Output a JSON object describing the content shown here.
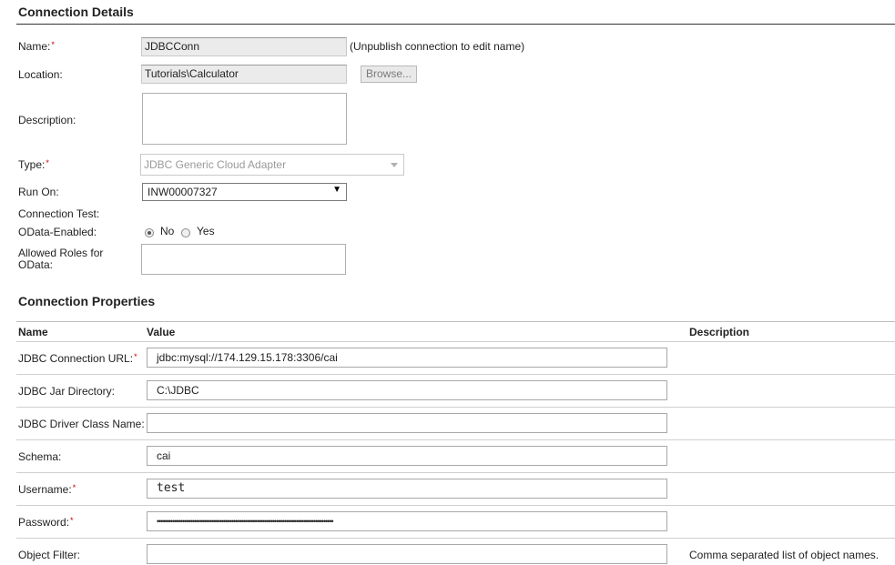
{
  "connection_details": {
    "title": "Connection Details",
    "name": {
      "label": "Name:",
      "required_marker": "*",
      "value": "JDBCConn",
      "note": "(Unpublish connection to edit name)"
    },
    "location": {
      "label": "Location:",
      "value": "Tutorials\\Calculator",
      "browse_label": "Browse..."
    },
    "description": {
      "label": "Description:",
      "value": ""
    },
    "type": {
      "label": "Type:",
      "required_marker": "*",
      "value": "JDBC Generic Cloud Adapter"
    },
    "run_on": {
      "label": "Run On:",
      "value": "INW00007327"
    },
    "connection_test": {
      "label": "Connection Test:"
    },
    "odata_enabled": {
      "label": "OData-Enabled:",
      "options": [
        "No",
        "Yes"
      ],
      "selected": "No"
    },
    "allowed_roles": {
      "label_line1": "Allowed Roles for",
      "label_line2": "OData:",
      "value": ""
    }
  },
  "connection_properties": {
    "title": "Connection Properties",
    "columns": {
      "name": "Name",
      "value": "Value",
      "description": "Description"
    },
    "rows": [
      {
        "label": "JDBC Connection URL:",
        "required_marker": "*",
        "value": "jdbc:mysql://174.129.15.178:3306/cai",
        "description": ""
      },
      {
        "label": "JDBC Jar Directory:",
        "required_marker": "",
        "value": "C:\\JDBC",
        "description": ""
      },
      {
        "label": "JDBC Driver Class Name:",
        "required_marker": "",
        "value": "",
        "description": ""
      },
      {
        "label": "Schema:",
        "required_marker": "",
        "value": "cai",
        "description": ""
      },
      {
        "label": "Username:",
        "required_marker": "*",
        "value": "test",
        "description": ""
      },
      {
        "label": "Password:",
        "required_marker": "*",
        "value": "••••••••••••••••••••••••••••••••••••••••••••••••••••••••••••••••••••••••••••••••••••••••••",
        "description": ""
      },
      {
        "label": "Object Filter:",
        "required_marker": "",
        "value": "",
        "description": "Comma separated list of object names."
      }
    ]
  }
}
